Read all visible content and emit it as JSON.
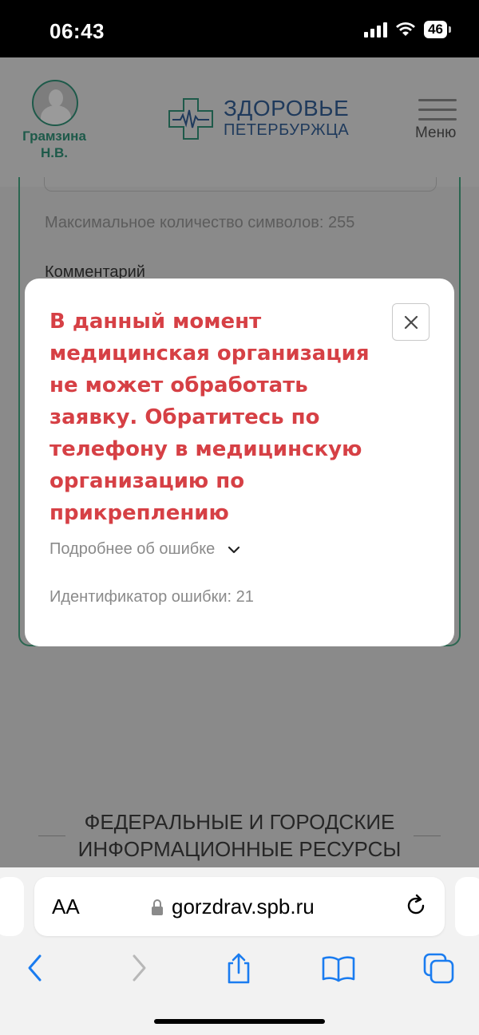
{
  "status_bar": {
    "time": "06:43",
    "battery": "46",
    "icons": [
      "cellular-signal-icon",
      "wifi-icon",
      "battery-icon"
    ]
  },
  "header": {
    "user_name_line1": "Грамзина",
    "user_name_line2": "Н.В.",
    "logo_line1": "ЗДОРОВЬЕ",
    "logo_line2": "ПЕТЕРБУРЖЦА",
    "menu_label": "Меню"
  },
  "form": {
    "max_chars_hint": "Максимальное количество символов: 255",
    "comment_label": "Комментарий"
  },
  "footer": {
    "resources_title": "ФЕДЕРАЛЬНЫЕ И ГОРОДСКИЕ ИНФОРМАЦИОННЫЕ РЕСУРСЫ"
  },
  "modal": {
    "message": "В данный момент медицинская организация не может обработать заявку. Обратитесь по телефону в медицинскую организацию по прикреплению",
    "details_link": "Подробнее об ошибке",
    "error_id": "Идентификатор ошибки: 21",
    "close_icon": "close-icon"
  },
  "browser": {
    "text_size_button": "AA",
    "url": "gorzdrav.spb.ru",
    "toolbar_icons": [
      "back-icon",
      "forward-icon",
      "share-icon",
      "bookmarks-icon",
      "tabs-icon"
    ]
  },
  "colors": {
    "error_text": "#d64045",
    "brand_green": "#1e5a4a",
    "brand_navy": "#1f3a5c",
    "ios_blue": "#1a7cf0",
    "overlay_grey": "#8a8a8a"
  }
}
